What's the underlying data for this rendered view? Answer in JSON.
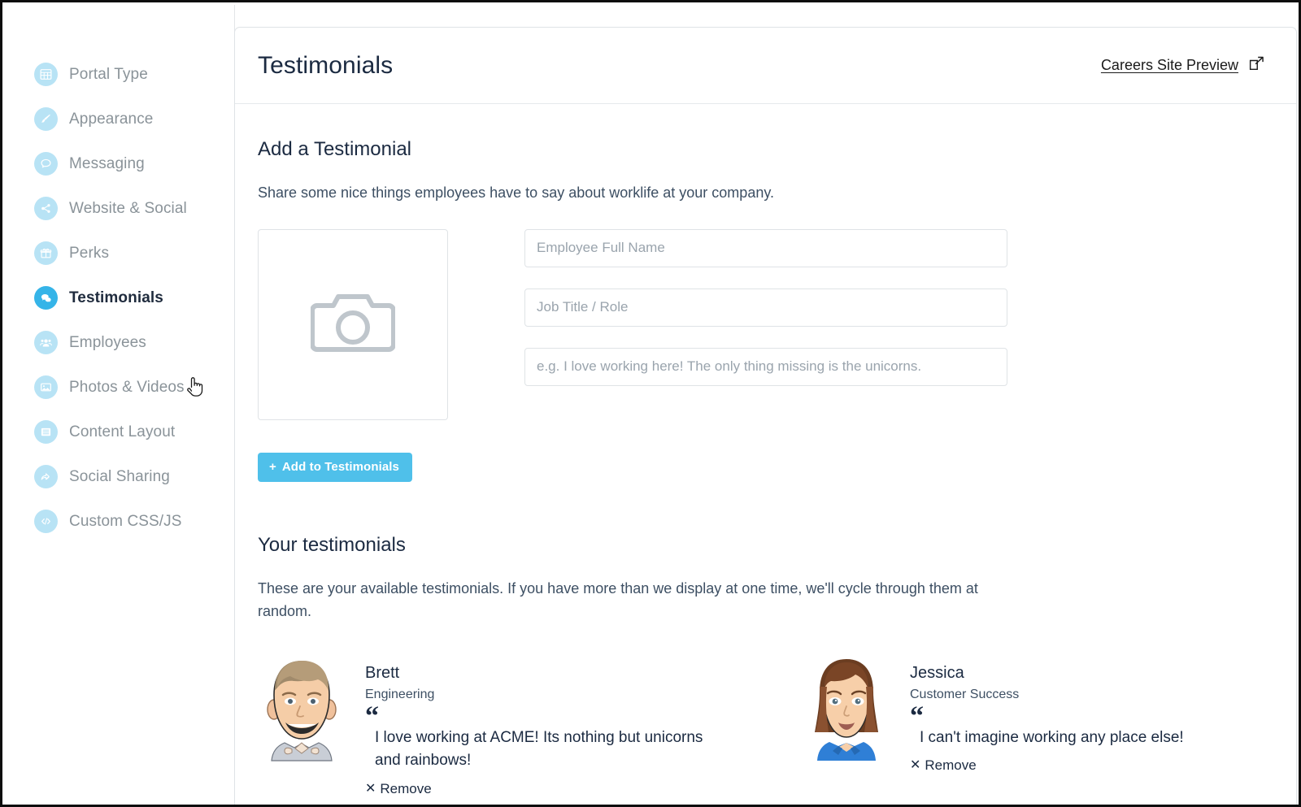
{
  "sidebar": {
    "items": [
      {
        "label": "Portal Type",
        "icon": "grid-icon",
        "active": false
      },
      {
        "label": "Appearance",
        "icon": "paintbrush-icon",
        "active": false
      },
      {
        "label": "Messaging",
        "icon": "chat-bubble-icon",
        "active": false
      },
      {
        "label": "Website & Social",
        "icon": "share-nodes-icon",
        "active": false
      },
      {
        "label": "Perks",
        "icon": "gift-icon",
        "active": false
      },
      {
        "label": "Testimonials",
        "icon": "chat-bubbles-icon",
        "active": true
      },
      {
        "label": "Employees",
        "icon": "people-group-icon",
        "active": false
      },
      {
        "label": "Photos & Videos",
        "icon": "image-icon",
        "active": false
      },
      {
        "label": "Content Layout",
        "icon": "lines-icon",
        "active": false
      },
      {
        "label": "Social Sharing",
        "icon": "share-arrow-icon",
        "active": false
      },
      {
        "label": "Custom CSS/JS",
        "icon": "code-icon",
        "active": false
      }
    ]
  },
  "header": {
    "title": "Testimonials",
    "preview_link": "Careers Site Preview",
    "preview_icon": "external-link-icon"
  },
  "add_section": {
    "title": "Add a Testimonial",
    "description": "Share some nice things employees have to say about worklife at your company.",
    "photo_upload_icon": "camera-icon",
    "fields": {
      "name_placeholder": "Employee Full Name",
      "name_value": "",
      "role_placeholder": "Job Title / Role",
      "role_value": "",
      "quote_placeholder": "e.g. I love working here! The only thing missing is the unicorns.",
      "quote_value": ""
    },
    "submit_label": "Add to Testimonials",
    "submit_icon": "plus-icon",
    "submit_color": "#4fc0ea"
  },
  "list_section": {
    "title": "Your testimonials",
    "description": "These are your available testimonials. If you have more than we display at one time, we'll cycle through them at random.",
    "remove_label": "Remove",
    "remove_icon": "close-icon",
    "items": [
      {
        "name": "Brett",
        "role": "Engineering",
        "quote": "I love working at ACME! Its nothing but unicorns and rainbows!",
        "avatar": "male-cartoon-avatar"
      },
      {
        "name": "Jessica",
        "role": "Customer Success",
        "quote": "I can't imagine working any place else!",
        "avatar": "female-cartoon-avatar"
      }
    ]
  },
  "cursor": {
    "type": "pointing-hand-cursor"
  }
}
